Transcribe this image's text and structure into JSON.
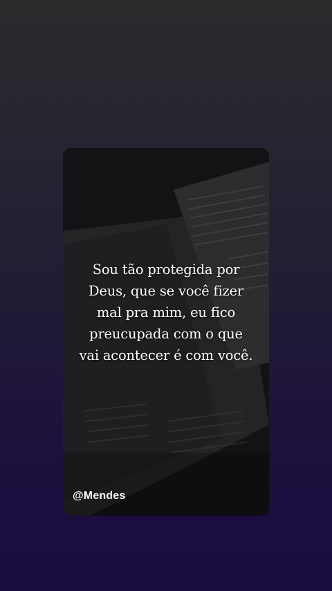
{
  "story": {
    "quote": "Sou tão protegida por Deus, que se você fizer mal pra mim, eu fico preucupada com o que vai acontecer é com você.",
    "author_handle": "@Mendes",
    "background_image": "book-pages-photo"
  },
  "colors": {
    "text": "#ffffff",
    "backdrop_top": "#2a2a2c",
    "backdrop_bottom": "#1a0c3e"
  }
}
